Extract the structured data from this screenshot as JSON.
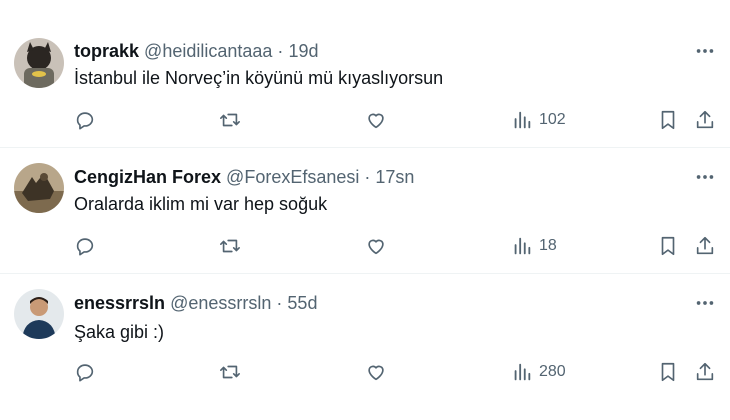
{
  "tweets": [
    {
      "name": "toprakk",
      "handle": "@heidilicantaaa",
      "separator": "·",
      "time": "19d",
      "text": "İstanbul ile Norveç’in köyünü mü kıyaslıyorsun",
      "views": "102"
    },
    {
      "name": "CengizHan Forex",
      "handle": "@ForexEfsanesi",
      "separator": "·",
      "time": "17sn",
      "text": "Oralarda iklim mi var hep soğuk",
      "views": "18"
    },
    {
      "name": "enessrrsln",
      "handle": "@enessrrsln",
      "separator": "·",
      "time": "55d",
      "text": "Şaka gibi :)",
      "views": "280"
    }
  ],
  "icons": {
    "reply": "reply-icon",
    "retweet": "retweet-icon",
    "like": "heart-icon",
    "views": "bar-chart-icon",
    "bookmark": "bookmark-icon",
    "share": "share-icon",
    "more": "more-icon"
  },
  "colors": {
    "text": "#0f1419",
    "secondary": "#536471",
    "divider": "#eff3f4"
  }
}
